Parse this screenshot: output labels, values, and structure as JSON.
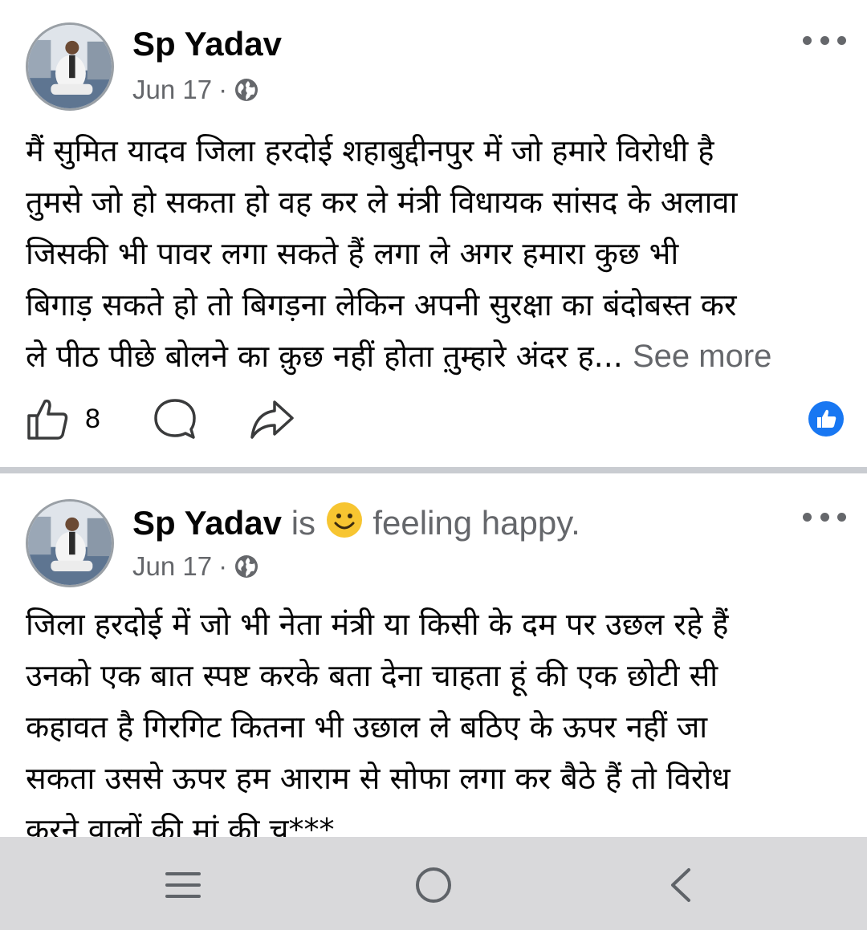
{
  "posts": [
    {
      "author": "Sp Yadav",
      "feeling": "",
      "date": "Jun 17",
      "separator": "·",
      "privacy_icon": "globe-icon",
      "lines": [
        "मैं सुमित यादव जिला हरदोई शहाबुद्दीनपुर में जो हमारे विरोधी है",
        "तुमसे जो हो सकता हो वह कर ले मंत्री विधायक सांसद के अलावा",
        "जिसकी भी पावर लगा सकते हैं लगा ले अगर हमारा कुछ भी",
        "बिगाड़ सकते हो तो बिगड़ना लेकिन अपनी सुरक्षा का बंदोबस्त कर",
        "ले पीठ पीछे बोलने का क़ुछ नहीं होता त़ुम्हारे अंदर ह..."
      ],
      "see_more": "See more",
      "like_count": "8"
    },
    {
      "author": "Sp Yadav",
      "feeling_prefix": "is",
      "feeling": "feeling happy.",
      "date": "Jun 17",
      "separator": "·",
      "privacy_icon": "globe-icon",
      "lines": [
        "जिला हरदोई में जो भी नेता मंत्री या किसी के दम पर उछल रहे हैं",
        "उनको एक बात स्पष्ट करके बता देना चाहता हूं की एक छोटी सी",
        "कहावत है गिरगिट कितना भी उछाल ले बठिए के ऊपर नहीं जा",
        "सकता उससे ऊपर हम आराम से सोफा लगा कर बैठे हैं तो विरोध",
        "करने वालों की मां की च***"
      ]
    }
  ],
  "colors": {
    "text": "#050505",
    "secondary_text": "#65676b",
    "facebook_blue": "#1877f2",
    "divider": "#c9ccd1",
    "nav_bar": "#d9d9db"
  },
  "icons": {
    "like": "thumbs-up-icon",
    "comment": "comment-bubble-icon",
    "share": "share-arrow-icon",
    "reaction": "like-reaction-badge-icon",
    "more": "more-options-icon",
    "feeling_emoji": "smiley-emoji-icon"
  },
  "nav": {
    "recents_icon": "recents-icon",
    "home_icon": "home-circle-icon",
    "back_icon": "back-chevron-icon"
  }
}
